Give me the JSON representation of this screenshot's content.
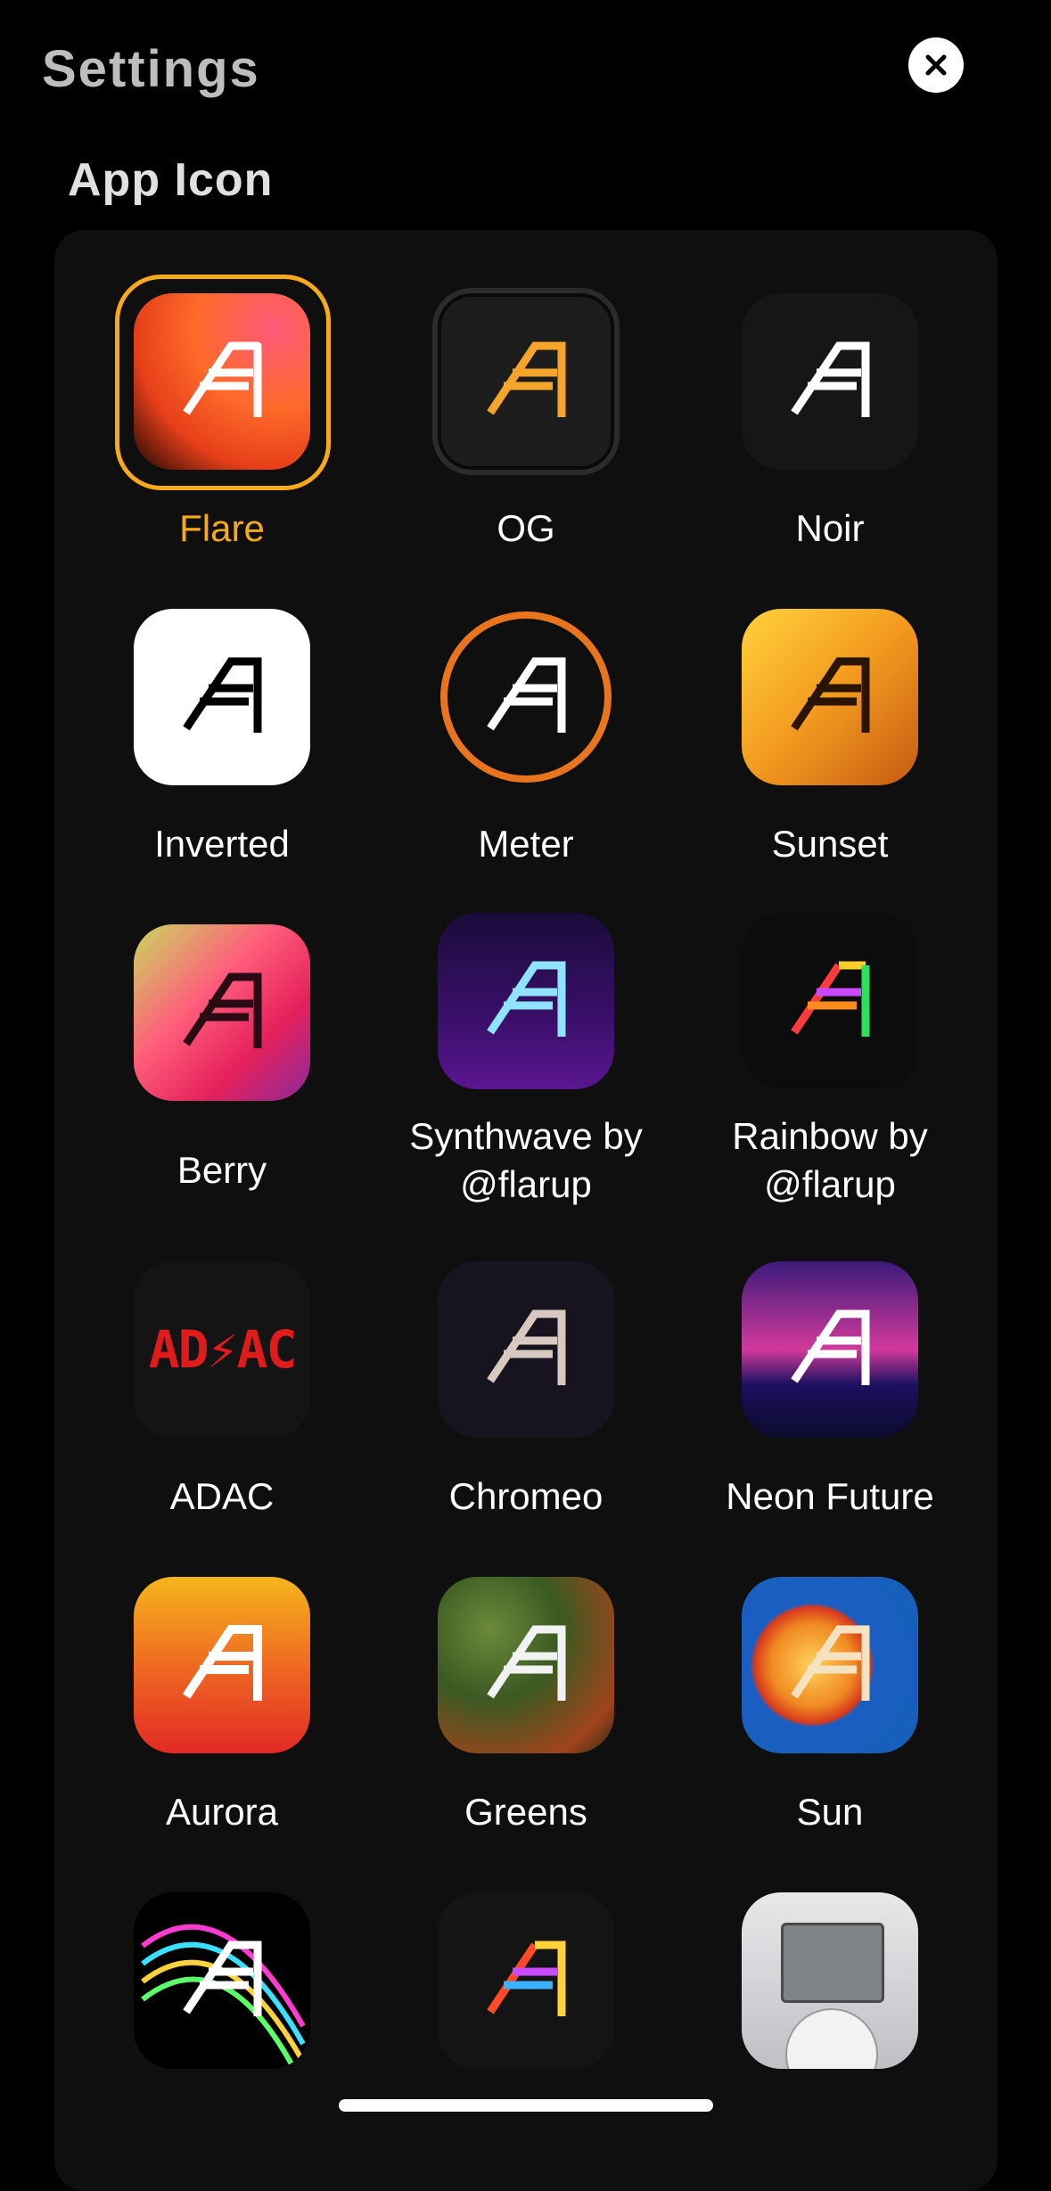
{
  "header": {
    "title": "Settings"
  },
  "section": {
    "title": "App Icon"
  },
  "icons": [
    {
      "label": "Flare",
      "selected": true
    },
    {
      "label": "OG"
    },
    {
      "label": "Noir"
    },
    {
      "label": "Inverted"
    },
    {
      "label": "Meter"
    },
    {
      "label": "Sunset"
    },
    {
      "label": "Berry"
    },
    {
      "label": "Synthwave by @flarup"
    },
    {
      "label": "Rainbow by @flarup"
    },
    {
      "label": "ADAC",
      "tile_text": "AD⚡AC"
    },
    {
      "label": "Chromeo"
    },
    {
      "label": "Neon Future"
    },
    {
      "label": "Aurora"
    },
    {
      "label": "Greens"
    },
    {
      "label": "Sun"
    },
    {
      "label": ""
    },
    {
      "label": ""
    },
    {
      "label": ""
    }
  ],
  "colors": {
    "accent": "#f6a91d",
    "background": "#000000",
    "panel": "#0f0f0f"
  }
}
